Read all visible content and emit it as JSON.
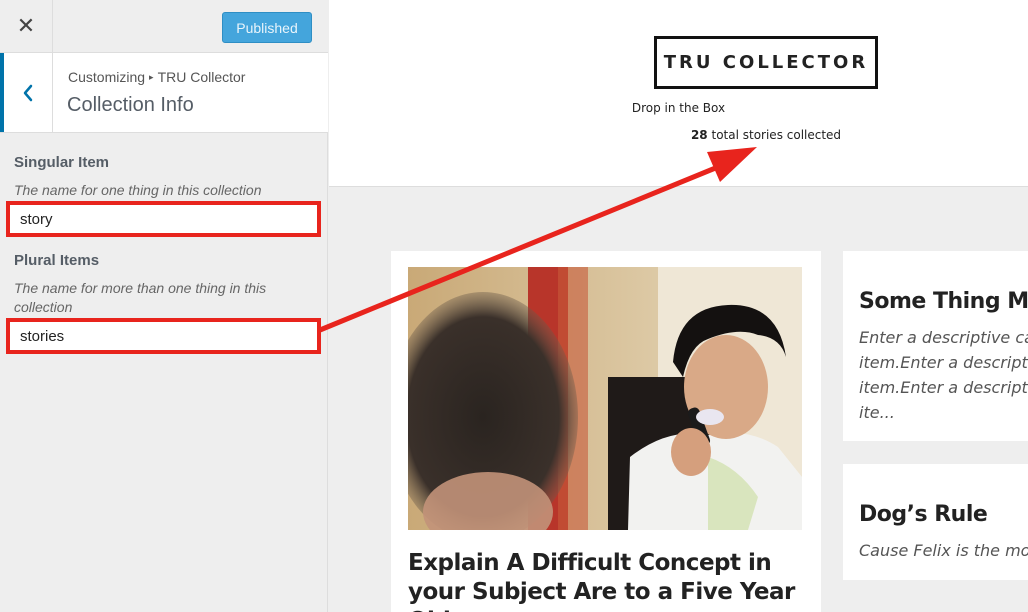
{
  "customizer": {
    "close_icon_glyph": "✕",
    "publish_label": "Published",
    "breadcrumb_prefix": "Customizing",
    "breadcrumb_site": "TRU Collector",
    "section_title": "Collection Info",
    "controls": [
      {
        "label": "Singular Item",
        "description": "The name for one thing in this collection",
        "value": "story"
      },
      {
        "label": "Plural Items",
        "description": "The name for more than one thing in this collection",
        "value": "stories"
      }
    ]
  },
  "preview": {
    "site_title": "TRU COLLECTOR",
    "tagline": "Drop in the Box",
    "count": "28",
    "count_suffix": "total stories collected",
    "posts": [
      {
        "title": "Explain A Difficult Concept in your Subject Are to a Five Year Old",
        "excerpt": ""
      },
      {
        "title": "Some Thing Ma",
        "excerpt_lines": [
          "Enter a descriptive capt",
          "item.Enter a descriptive",
          "item.Enter a descriptive",
          "ite..."
        ]
      },
      {
        "title": "Dog’s Rule",
        "excerpt_lines": [
          "Cause Felix is the most s"
        ]
      }
    ]
  },
  "colors": {
    "highlight": "#e8241d",
    "publish": "#44a5dc",
    "back_accent": "#0073aa"
  },
  "icons": [
    "close-icon",
    "back-arrow-icon",
    "annotation-arrow-icon"
  ]
}
